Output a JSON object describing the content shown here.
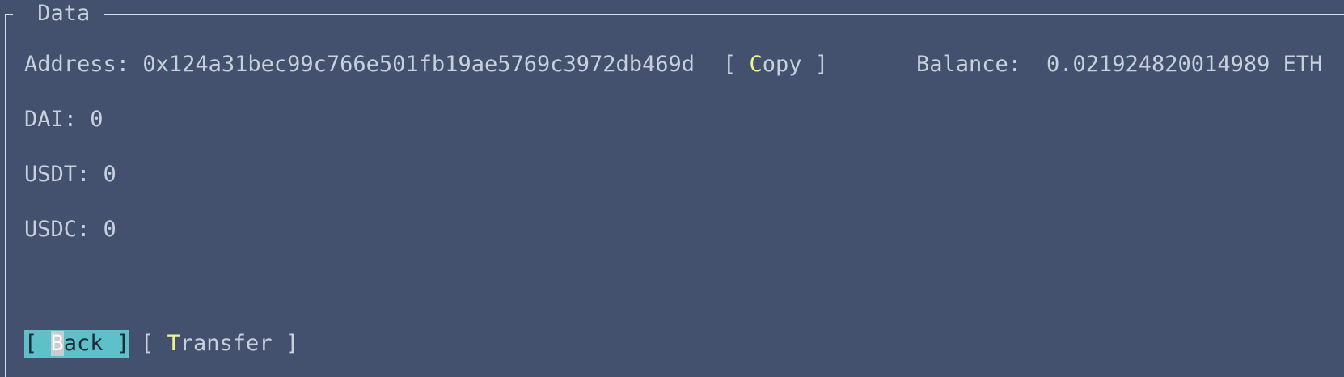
{
  "frame": {
    "title": "Data"
  },
  "account": {
    "address_label": "Address:",
    "address": "0x124a31bec99c766e501fb19ae5769c3972db469d",
    "copy_open": "[ ",
    "copy_hotkey": "C",
    "copy_rest": "opy",
    "copy_close": " ]",
    "balance_label": "Balance:",
    "balance_value": "0.021924820014989 ETH"
  },
  "tokens": [
    {
      "label": "DAI:",
      "value": "0"
    },
    {
      "label": "USDT:",
      "value": "0"
    },
    {
      "label": "USDC:",
      "value": "0"
    }
  ],
  "actions": {
    "back_open": "[ ",
    "back_hotkey": "B",
    "back_rest": "ack",
    "back_close": " ]",
    "transfer_open": "[ ",
    "transfer_hotkey": "T",
    "transfer_rest": "ransfer",
    "transfer_close": " ]"
  },
  "colors": {
    "background": "#43516f",
    "text": "#c9d0dc",
    "hotkey": "#f2f28c",
    "focused_button": "#5ec1c9"
  }
}
